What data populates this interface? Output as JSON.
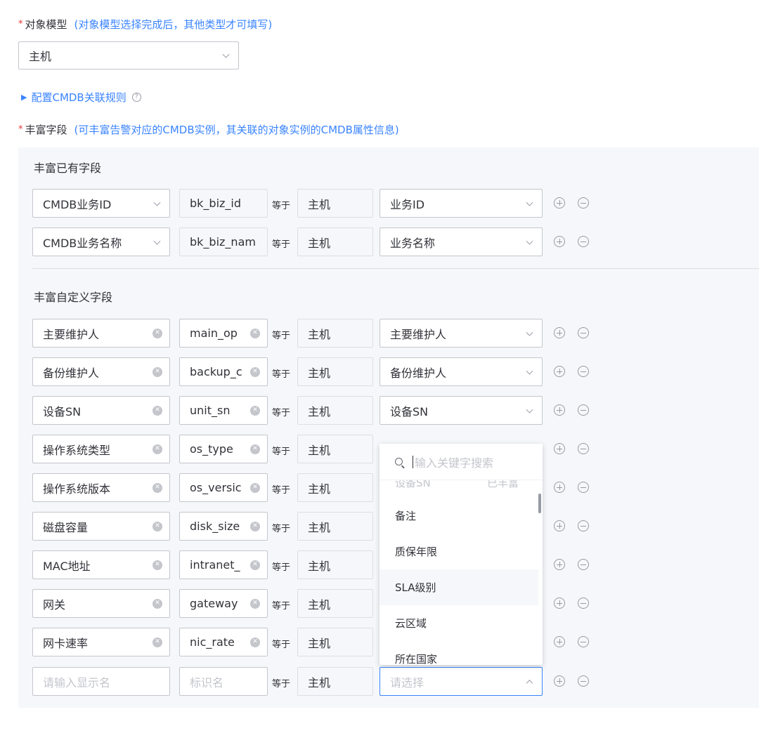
{
  "object_model": {
    "label": "对象模型",
    "hint": "(对象模型选择完成后，其他类型才可填写)",
    "value": "主机"
  },
  "cmdb_rule_link": "配置CMDB关联规则",
  "enrich_fields": {
    "label": "丰富字段",
    "hint": "(可丰富告警对应的CMDB实例，其关联的对象实例的CMDB属性信息)"
  },
  "existing_section": {
    "title": "丰富已有字段",
    "rows": [
      {
        "display": "CMDB业务ID",
        "key": "bk_biz_id",
        "op": "等于",
        "object": "主机",
        "attr": "业务ID"
      },
      {
        "display": "CMDB业务名称",
        "key": "bk_biz_nam",
        "op": "等于",
        "object": "主机",
        "attr": "业务名称"
      }
    ]
  },
  "custom_section": {
    "title": "丰富自定义字段",
    "rows": [
      {
        "display": "主要维护人",
        "key": "main_op",
        "op": "等于",
        "object": "主机",
        "attr": "主要维护人"
      },
      {
        "display": "备份维护人",
        "key": "backup_c",
        "op": "等于",
        "object": "主机",
        "attr": "备份维护人"
      },
      {
        "display": "设备SN",
        "key": "unit_sn",
        "op": "等于",
        "object": "主机",
        "attr": "设备SN"
      },
      {
        "display": "操作系统类型",
        "key": "os_type",
        "op": "等于",
        "object": "主机",
        "attr": ""
      },
      {
        "display": "操作系统版本",
        "key": "os_versic",
        "op": "等于",
        "object": "主机",
        "attr": ""
      },
      {
        "display": "磁盘容量",
        "key": "disk_size",
        "op": "等于",
        "object": "主机",
        "attr": ""
      },
      {
        "display": "MAC地址",
        "key": "intranet_",
        "op": "等于",
        "object": "主机",
        "attr": ""
      },
      {
        "display": "网关",
        "key": "gateway",
        "op": "等于",
        "object": "主机",
        "attr": ""
      },
      {
        "display": "网卡速率",
        "key": "nic_rate",
        "op": "等于",
        "object": "主机",
        "attr": ""
      }
    ],
    "new_row": {
      "display_placeholder": "请输入显示名",
      "key_placeholder": "标识名",
      "op": "等于",
      "object": "主机",
      "attr_placeholder": "请选择"
    }
  },
  "attr_dropdown": {
    "search_placeholder": "输入关键字搜索",
    "partial_item": {
      "label": "设备SN",
      "tag": "已丰富"
    },
    "items": [
      "备注",
      "质保年限",
      "SLA级别",
      "云区域",
      "所在国家"
    ],
    "highlighted": "SLA级别"
  },
  "colors": {
    "accent": "#3a84ff",
    "required": "#ea3636",
    "panel_bg": "#f5f7fa",
    "border": "#c4c6cc"
  }
}
